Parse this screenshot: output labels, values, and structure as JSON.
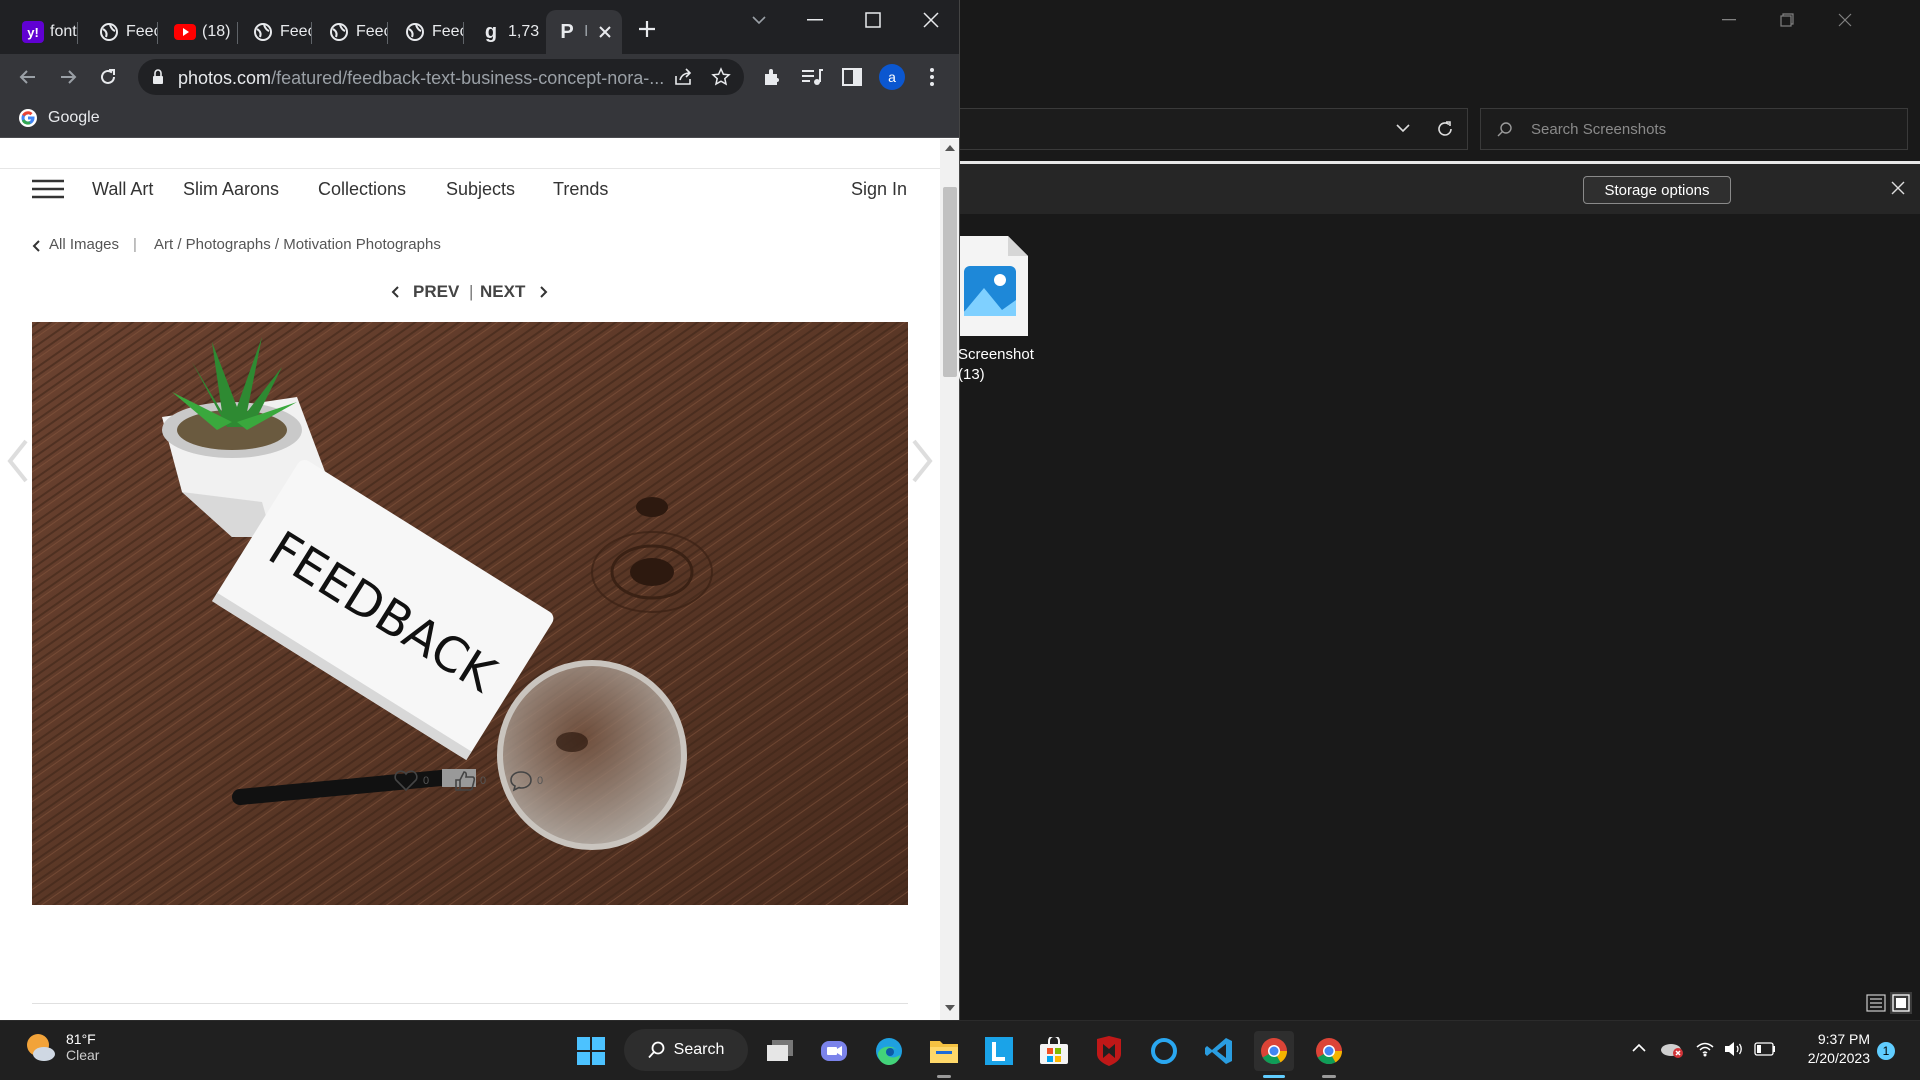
{
  "browser": {
    "tabs": [
      {
        "label": "font",
        "icon": "yahoo-icon"
      },
      {
        "label": "Feec",
        "icon": "globe-icon"
      },
      {
        "label": "(18)",
        "icon": "youtube-icon"
      },
      {
        "label": "Feec",
        "icon": "globe-icon"
      },
      {
        "label": "Feec",
        "icon": "globe-icon"
      },
      {
        "label": "Feec",
        "icon": "globe-icon"
      },
      {
        "label": "1,73",
        "icon": "g-icon"
      },
      {
        "label": "I",
        "icon": "p-icon"
      }
    ],
    "url_host": "photos.com",
    "url_path": "/featured/feedback-text-business-concept-nora-...",
    "profile_initial": "a",
    "bookmark_label": "Google"
  },
  "site": {
    "nav": [
      "Wall Art",
      "Slim Aarons",
      "Collections",
      "Subjects",
      "Trends"
    ],
    "sign_in": "Sign In",
    "all_images": "All Images",
    "breadcrumb_sep": "|",
    "breadcrumb": "Art / Photographs / Motivation Photographs",
    "prev": "PREV",
    "pager_sep": "|",
    "next": "NEXT",
    "card_text": "FEEDBACK",
    "likes": "0",
    "thumbs": "0",
    "comments": "0"
  },
  "explorer": {
    "search_placeholder": "Search Screenshots",
    "storage_options": "Storage options",
    "file_name_line1": "Screenshot",
    "file_name_line2": "(13)"
  },
  "taskbar": {
    "temp": "81°F",
    "condition": "Clear",
    "search_label": "Search",
    "time": "9:37 PM",
    "date": "2/20/2023",
    "notification_count": "1"
  },
  "colors": {
    "chrome_dark": "#202124",
    "chrome_toolbar": "#35363a",
    "explorer_bg": "#191919",
    "taskbar_bg": "#202020",
    "wood": "#5a3726",
    "accent_blue": "#0b6bcb"
  }
}
